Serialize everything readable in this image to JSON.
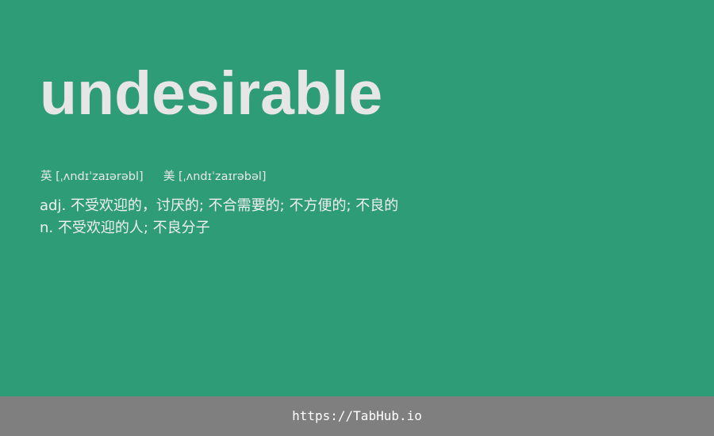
{
  "word": {
    "text": "undesirable"
  },
  "phonetics": {
    "uk_label": "英",
    "uk_ipa": "[ˌʌndɪˈzaɪərəbl]",
    "us_label": "美",
    "us_ipa": "[ˌʌndɪˈzaɪrəbəl]"
  },
  "definitions": [
    {
      "text": "adj. 不受欢迎的，讨厌的; 不合需要的; 不方便的; 不良的"
    },
    {
      "text": "n. 不受欢迎的人; 不良分子"
    }
  ],
  "footer": {
    "link_text": "https://TabHub.io"
  },
  "colors": {
    "background": "#2e9c76",
    "footer_background": "#7f7f7f",
    "word_text": "#e6e6e6"
  }
}
